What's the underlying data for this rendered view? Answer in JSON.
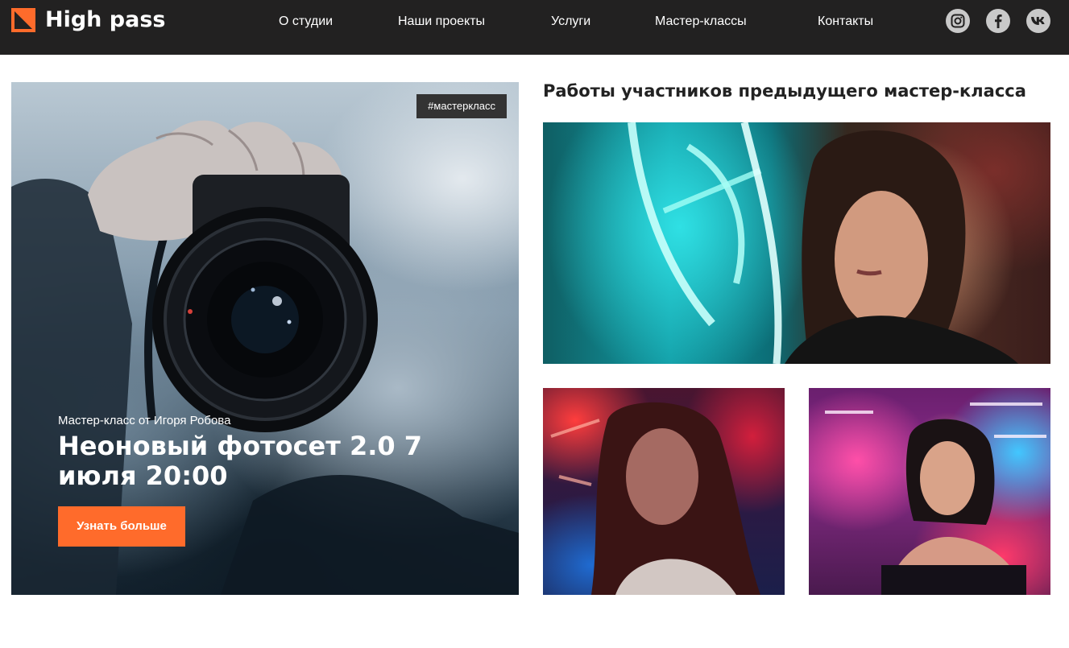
{
  "header": {
    "brand": "High pass",
    "nav": [
      "О студии",
      "Наши проекты",
      "Услуги",
      "Мастер-классы",
      "Контакты"
    ],
    "social": [
      "instagram-icon",
      "facebook-icon",
      "vk-icon"
    ]
  },
  "hero": {
    "tag": "#мастеркласс",
    "subtitle": "Мастер-класс от Игоря Робова",
    "title": "Неоновый фотосет 2.0 7 июля 20:00",
    "button": "Узнать больше"
  },
  "gallery": {
    "title": "Работы участников предыдущего мастер-класса"
  },
  "colors": {
    "header_bg": "#222121",
    "accent": "#ff6b2b",
    "tag_bg": "#333333",
    "social_bg": "#c9c9c9"
  }
}
